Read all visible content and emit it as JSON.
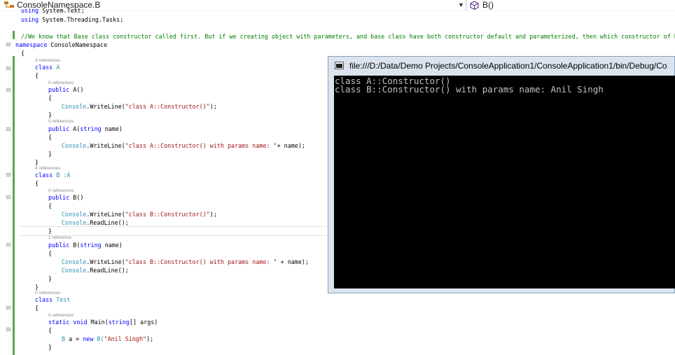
{
  "navbar": {
    "left_label": "ConsoleNamespace.B",
    "left_icon": "class-icon",
    "right_label": "B()",
    "right_icon": "method-cube-icon"
  },
  "code": {
    "l_using1": "using System.Text;",
    "l_using2": "using System.Threading.Tasks;",
    "l_comment": "//We know that Base class constructor called first. But if we creating object with parameters, and base class have both constructor default and parameterized, then which constructor of basecla",
    "l_ns_kw": "namespace",
    "l_ns_name": " ConsoleNamespace",
    "brace_open": "{",
    "brace_close": "}",
    "lens_3refs": "3 references",
    "lens_0refs": "0 references",
    "lens_4refs": "4 references",
    "lens_1ref": "1 reference",
    "kw_class": "class",
    "kw_public": "public",
    "kw_string": "string",
    "kw_static": "static",
    "kw_void": "void",
    "kw_new": "new",
    "class_a": " A",
    "class_b": " B :A",
    "class_test": " Test",
    "ctor_a_default": " A()",
    "ctor_a_param_open": " A(",
    "ctor_param_name": " name)",
    "ctor_b_default": " B()",
    "ctor_b_param_open": " B(",
    "console_type": "Console",
    "writeline_open": ".WriteLine(",
    "readline": ".ReadLine();",
    "str_a1": "\"class A::Constructor()\"",
    "str_a2": "\"class A::Constructor() with params name: \"",
    "concat_a2": "+ name);",
    "str_b1": "\"class B::Constructor()\"",
    "str_b2": "\"class B::Constructor() with params name: \"",
    "concat_b2": " + name);",
    "close_paren_semi": ");",
    "main_sig": " Main(",
    "main_args": "[] args)",
    "b_decl": "B a = ",
    "b_ctor_type": " B(",
    "b_ctor_arg": "\"Anil Singh\"",
    "b_ctor_end": ");"
  },
  "console": {
    "title": "file:///D:/Data/Demo Projects/ConsoleApplication1/ConsoleApplication1/bin/Debug/Co",
    "lines": [
      "class A::Constructor()",
      "class B::Constructor() with params name: Anil Singh"
    ]
  }
}
